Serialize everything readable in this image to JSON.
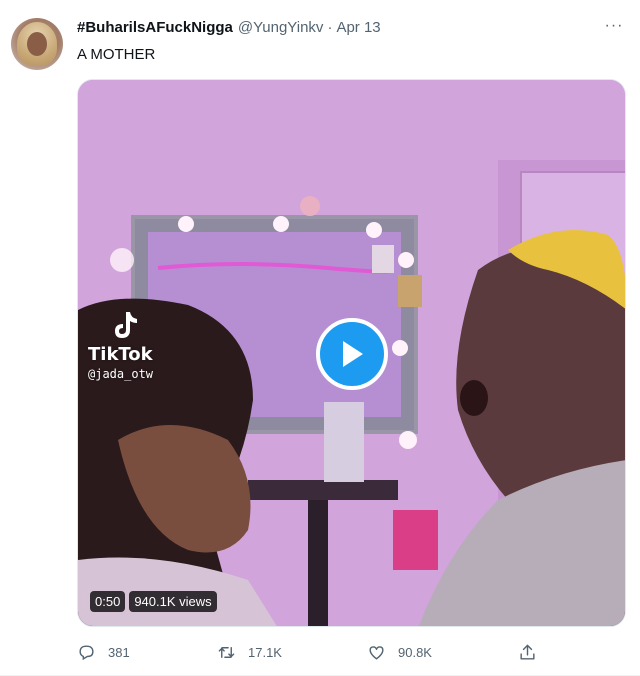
{
  "tweet": {
    "display_name": "#BuharilsAFuckNigga",
    "handle": "@YungYinkv",
    "separator": "·",
    "date": "Apr 13",
    "more_label": "···",
    "text": "A MOTHER"
  },
  "media": {
    "type": "video",
    "watermark_brand": "TikTok",
    "watermark_user": "@jada_otw",
    "duration": "0:50",
    "views": "940.1K views",
    "accent_color": "#1d9bf0"
  },
  "actions": {
    "reply_count": "381",
    "retweet_count": "17.1K",
    "like_count": "90.8K",
    "icons": [
      "reply-icon",
      "retweet-icon",
      "like-icon",
      "share-icon"
    ]
  }
}
